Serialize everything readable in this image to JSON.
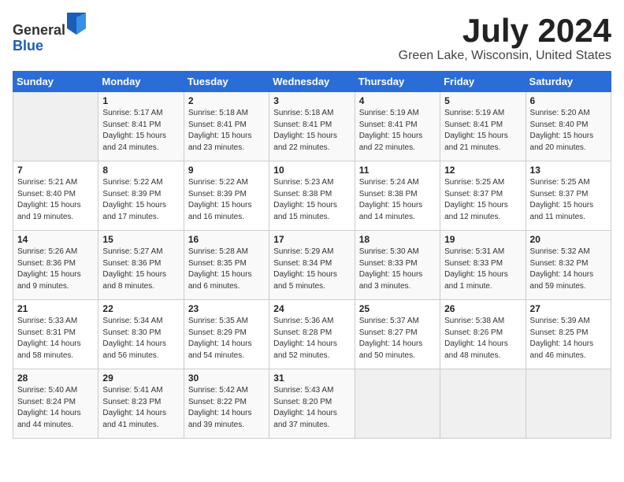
{
  "logo": {
    "general": "General",
    "blue": "Blue"
  },
  "title": "July 2024",
  "subtitle": "Green Lake, Wisconsin, United States",
  "weekdays": [
    "Sunday",
    "Monday",
    "Tuesday",
    "Wednesday",
    "Thursday",
    "Friday",
    "Saturday"
  ],
  "weeks": [
    [
      {
        "day": "",
        "info": ""
      },
      {
        "day": "1",
        "info": "Sunrise: 5:17 AM\nSunset: 8:41 PM\nDaylight: 15 hours\nand 24 minutes."
      },
      {
        "day": "2",
        "info": "Sunrise: 5:18 AM\nSunset: 8:41 PM\nDaylight: 15 hours\nand 23 minutes."
      },
      {
        "day": "3",
        "info": "Sunrise: 5:18 AM\nSunset: 8:41 PM\nDaylight: 15 hours\nand 22 minutes."
      },
      {
        "day": "4",
        "info": "Sunrise: 5:19 AM\nSunset: 8:41 PM\nDaylight: 15 hours\nand 22 minutes."
      },
      {
        "day": "5",
        "info": "Sunrise: 5:19 AM\nSunset: 8:41 PM\nDaylight: 15 hours\nand 21 minutes."
      },
      {
        "day": "6",
        "info": "Sunrise: 5:20 AM\nSunset: 8:40 PM\nDaylight: 15 hours\nand 20 minutes."
      }
    ],
    [
      {
        "day": "7",
        "info": "Sunrise: 5:21 AM\nSunset: 8:40 PM\nDaylight: 15 hours\nand 19 minutes."
      },
      {
        "day": "8",
        "info": "Sunrise: 5:22 AM\nSunset: 8:39 PM\nDaylight: 15 hours\nand 17 minutes."
      },
      {
        "day": "9",
        "info": "Sunrise: 5:22 AM\nSunset: 8:39 PM\nDaylight: 15 hours\nand 16 minutes."
      },
      {
        "day": "10",
        "info": "Sunrise: 5:23 AM\nSunset: 8:38 PM\nDaylight: 15 hours\nand 15 minutes."
      },
      {
        "day": "11",
        "info": "Sunrise: 5:24 AM\nSunset: 8:38 PM\nDaylight: 15 hours\nand 14 minutes."
      },
      {
        "day": "12",
        "info": "Sunrise: 5:25 AM\nSunset: 8:37 PM\nDaylight: 15 hours\nand 12 minutes."
      },
      {
        "day": "13",
        "info": "Sunrise: 5:25 AM\nSunset: 8:37 PM\nDaylight: 15 hours\nand 11 minutes."
      }
    ],
    [
      {
        "day": "14",
        "info": "Sunrise: 5:26 AM\nSunset: 8:36 PM\nDaylight: 15 hours\nand 9 minutes."
      },
      {
        "day": "15",
        "info": "Sunrise: 5:27 AM\nSunset: 8:36 PM\nDaylight: 15 hours\nand 8 minutes."
      },
      {
        "day": "16",
        "info": "Sunrise: 5:28 AM\nSunset: 8:35 PM\nDaylight: 15 hours\nand 6 minutes."
      },
      {
        "day": "17",
        "info": "Sunrise: 5:29 AM\nSunset: 8:34 PM\nDaylight: 15 hours\nand 5 minutes."
      },
      {
        "day": "18",
        "info": "Sunrise: 5:30 AM\nSunset: 8:33 PM\nDaylight: 15 hours\nand 3 minutes."
      },
      {
        "day": "19",
        "info": "Sunrise: 5:31 AM\nSunset: 8:33 PM\nDaylight: 15 hours\nand 1 minute."
      },
      {
        "day": "20",
        "info": "Sunrise: 5:32 AM\nSunset: 8:32 PM\nDaylight: 14 hours\nand 59 minutes."
      }
    ],
    [
      {
        "day": "21",
        "info": "Sunrise: 5:33 AM\nSunset: 8:31 PM\nDaylight: 14 hours\nand 58 minutes."
      },
      {
        "day": "22",
        "info": "Sunrise: 5:34 AM\nSunset: 8:30 PM\nDaylight: 14 hours\nand 56 minutes."
      },
      {
        "day": "23",
        "info": "Sunrise: 5:35 AM\nSunset: 8:29 PM\nDaylight: 14 hours\nand 54 minutes."
      },
      {
        "day": "24",
        "info": "Sunrise: 5:36 AM\nSunset: 8:28 PM\nDaylight: 14 hours\nand 52 minutes."
      },
      {
        "day": "25",
        "info": "Sunrise: 5:37 AM\nSunset: 8:27 PM\nDaylight: 14 hours\nand 50 minutes."
      },
      {
        "day": "26",
        "info": "Sunrise: 5:38 AM\nSunset: 8:26 PM\nDaylight: 14 hours\nand 48 minutes."
      },
      {
        "day": "27",
        "info": "Sunrise: 5:39 AM\nSunset: 8:25 PM\nDaylight: 14 hours\nand 46 minutes."
      }
    ],
    [
      {
        "day": "28",
        "info": "Sunrise: 5:40 AM\nSunset: 8:24 PM\nDaylight: 14 hours\nand 44 minutes."
      },
      {
        "day": "29",
        "info": "Sunrise: 5:41 AM\nSunset: 8:23 PM\nDaylight: 14 hours\nand 41 minutes."
      },
      {
        "day": "30",
        "info": "Sunrise: 5:42 AM\nSunset: 8:22 PM\nDaylight: 14 hours\nand 39 minutes."
      },
      {
        "day": "31",
        "info": "Sunrise: 5:43 AM\nSunset: 8:20 PM\nDaylight: 14 hours\nand 37 minutes."
      },
      {
        "day": "",
        "info": ""
      },
      {
        "day": "",
        "info": ""
      },
      {
        "day": "",
        "info": ""
      }
    ]
  ]
}
